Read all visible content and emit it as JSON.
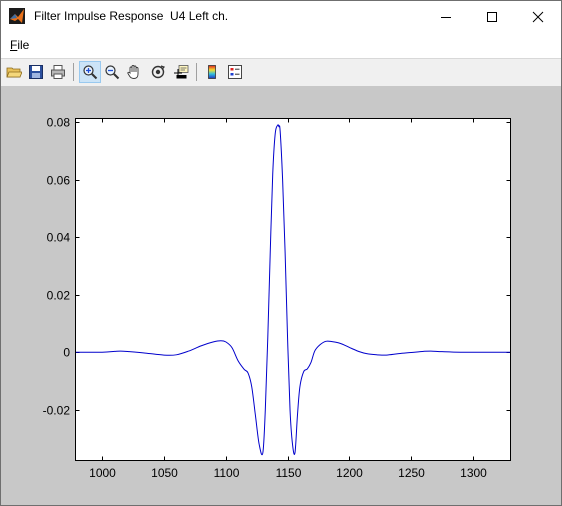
{
  "window": {
    "title": "Filter Impulse Response  U4 Left ch.",
    "minimize_glyph": "—",
    "maximize_glyph": "☐",
    "close_glyph": "✕"
  },
  "menu": {
    "file_first_letter": "F",
    "file_rest": "ile"
  },
  "toolbar": {
    "buttons": [
      {
        "name": "open-file-icon"
      },
      {
        "name": "save-icon"
      },
      {
        "name": "print-icon"
      },
      {
        "name": "zoom-in-icon",
        "active": true
      },
      {
        "name": "zoom-out-icon"
      },
      {
        "name": "pan-hand-icon"
      },
      {
        "name": "rotate-3d-icon"
      },
      {
        "name": "data-cursor-icon"
      },
      {
        "name": "colorbar-icon"
      },
      {
        "name": "legend-icon"
      }
    ]
  },
  "colors": {
    "figure_bg": "#c8c8c8",
    "axes_bg": "#ffffff",
    "line": "#0000cc"
  },
  "chart_data": {
    "type": "line",
    "title": "",
    "xlabel": "",
    "ylabel": "",
    "xlim": [
      978,
      1330
    ],
    "ylim": [
      -0.0375,
      0.0815
    ],
    "x_ticks": [
      1000,
      1050,
      1100,
      1150,
      1200,
      1250,
      1300
    ],
    "y_ticks": [
      0.08,
      0.06,
      0.04,
      0.02,
      0,
      -0.02
    ],
    "x_tick_labels": [
      "1000",
      "1050",
      "1100",
      "1150",
      "1200",
      "1250",
      "1300"
    ],
    "y_tick_labels": [
      "0.08",
      "0.06",
      "0.04",
      "0.02",
      "0",
      "-0.02"
    ],
    "grid": false,
    "series": [
      {
        "x": [
          978,
          1000,
          1010,
          1015,
          1022,
          1035,
          1050,
          1060,
          1070,
          1080,
          1090,
          1096,
          1100,
          1105,
          1110,
          1115,
          1118,
          1121,
          1124,
          1127,
          1130,
          1132,
          1134,
          1136,
          1138,
          1140,
          1142,
          1143,
          1144,
          1146,
          1148,
          1150,
          1152,
          1154,
          1156,
          1158,
          1160,
          1163,
          1166,
          1169,
          1172,
          1176,
          1181,
          1186,
          1191,
          1196,
          1202,
          1208,
          1214,
          1222,
          1230,
          1240,
          1250,
          1260,
          1266,
          1275,
          1290,
          1310,
          1330
        ],
        "y": [
          0,
          0,
          0.0003,
          0.0004,
          0.0002,
          -0.0003,
          -0.001,
          -0.0009,
          0.0004,
          0.0022,
          0.0036,
          0.004,
          0.0036,
          0.0016,
          -0.003,
          -0.006,
          -0.0072,
          -0.012,
          -0.022,
          -0.032,
          -0.035,
          -0.02,
          0.005,
          0.035,
          0.062,
          0.076,
          0.079,
          0.0785,
          0.077,
          0.06,
          0.035,
          0.005,
          -0.02,
          -0.032,
          -0.035,
          -0.022,
          -0.012,
          -0.0068,
          -0.0058,
          -0.0035,
          0.0004,
          0.0025,
          0.0038,
          0.0037,
          0.0033,
          0.0025,
          0.0013,
          0.0002,
          -0.0005,
          -0.0009,
          -0.001,
          -0.0005,
          -0.0001,
          0.0003,
          0.0004,
          0.0002,
          0,
          0,
          0
        ]
      }
    ]
  }
}
